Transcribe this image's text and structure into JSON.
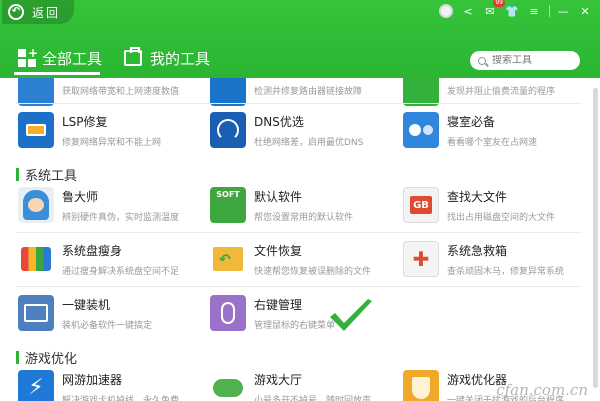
{
  "header": {
    "back_label": "返回",
    "tabs": [
      {
        "label": "全部工具",
        "active": true
      },
      {
        "label": "我的工具",
        "active": false
      }
    ],
    "search_placeholder": "搜索工具",
    "mail_badge": "99",
    "accent_color": "#2bb532"
  },
  "top_row": [
    {
      "desc": "获取网络带宽和上网速度数值",
      "icon": "speed-icon"
    },
    {
      "desc": "检测并修复路由器链接故障",
      "icon": "router-icon"
    },
    {
      "desc": "发现并阻止偷费流量的程序",
      "icon": "flow-icon"
    }
  ],
  "network_row": [
    {
      "name": "LSP修复",
      "desc": "修复网络异常和不能上网",
      "icon": "lsp-icon"
    },
    {
      "name": "DNS优选",
      "desc": "杜绝网络差，启用最优DNS",
      "icon": "dns-icon"
    },
    {
      "name": "寝室必备",
      "desc": "看看哪个室友在占网速",
      "icon": "dorm-icon"
    }
  ],
  "system_section": {
    "title": "系统工具",
    "rows": [
      [
        {
          "name": "鲁大师",
          "desc": "辨别硬件真伪，实时监测温度",
          "icon": "ludashi-icon"
        },
        {
          "name": "默认软件",
          "desc": "帮您设置常用的默认软件",
          "icon": "soft-icon",
          "icon_text": "SOFT"
        },
        {
          "name": "查找大文件",
          "desc": "找出占用磁盘空间的大文件",
          "icon": "gb-icon",
          "icon_text": "GB"
        }
      ],
      [
        {
          "name": "系统盘瘦身",
          "desc": "通过瘦身解决系统盘空间不足",
          "icon": "slim-icon"
        },
        {
          "name": "文件恢复",
          "desc": "快速帮您恢复被误删除的文件",
          "icon": "recover-icon"
        },
        {
          "name": "系统急救箱",
          "desc": "查杀顽固木马，修复异常系统",
          "icon": "firstaid-icon"
        }
      ],
      [
        {
          "name": "一键装机",
          "desc": "装机必备软件一键搞定",
          "icon": "install-icon"
        },
        {
          "name": "右键管理",
          "desc": "管理鼠标的右键菜单",
          "icon": "mouse-icon"
        }
      ]
    ]
  },
  "game_section": {
    "title": "游戏优化",
    "rows": [
      [
        {
          "name": "网游加速器",
          "desc": "解决游戏卡机掉线，永久免费",
          "icon": "accelerator-icon"
        },
        {
          "name": "游戏大厅",
          "desc": "小号多开不掉号，随时回放声",
          "icon": "gamepad-icon"
        },
        {
          "name": "游戏优化器",
          "desc": "一键关闭干扰游戏的后台程序",
          "icon": "optimizer-icon"
        }
      ]
    ]
  },
  "watermark": "cfan.com.cn"
}
